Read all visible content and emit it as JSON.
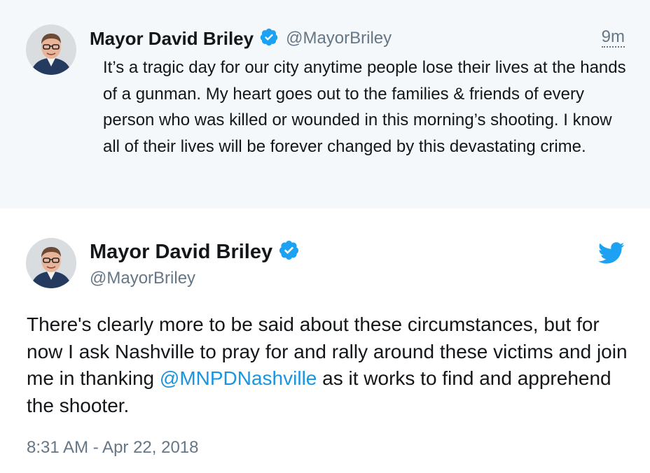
{
  "colors": {
    "verified": "#1da1f2",
    "twitter_bird": "#1da1f2",
    "mention": "#1b95e0",
    "muted": "#657786",
    "parent_background": "#f5f8fa"
  },
  "parent_tweet": {
    "name": "Mayor David Briley",
    "handle": "@MayorBriley",
    "time": "9m",
    "text": "It’s a tragic day for our city anytime people lose their lives at the hands of a gunman. My heart goes out to the families & friends of every person who was killed or wounded in this morning’s shooting. I know all of their lives will be forever changed by this devastating crime."
  },
  "main_tweet": {
    "name": "Mayor David Briley",
    "handle": "@MayorBriley",
    "text_before": "There's clearly more to be said about these circumstances, but for now I ask Nashville to pray for and rally around these victims and join me in thanking ",
    "mention": "@MNPDNashville",
    "text_after": " as it works to find and apprehend the shooter.",
    "timestamp": "8:31 AM - Apr 22, 2018"
  },
  "icons": {
    "verified": "verified-badge-icon",
    "bird": "twitter-bird-icon",
    "avatar": "profile-photo"
  }
}
